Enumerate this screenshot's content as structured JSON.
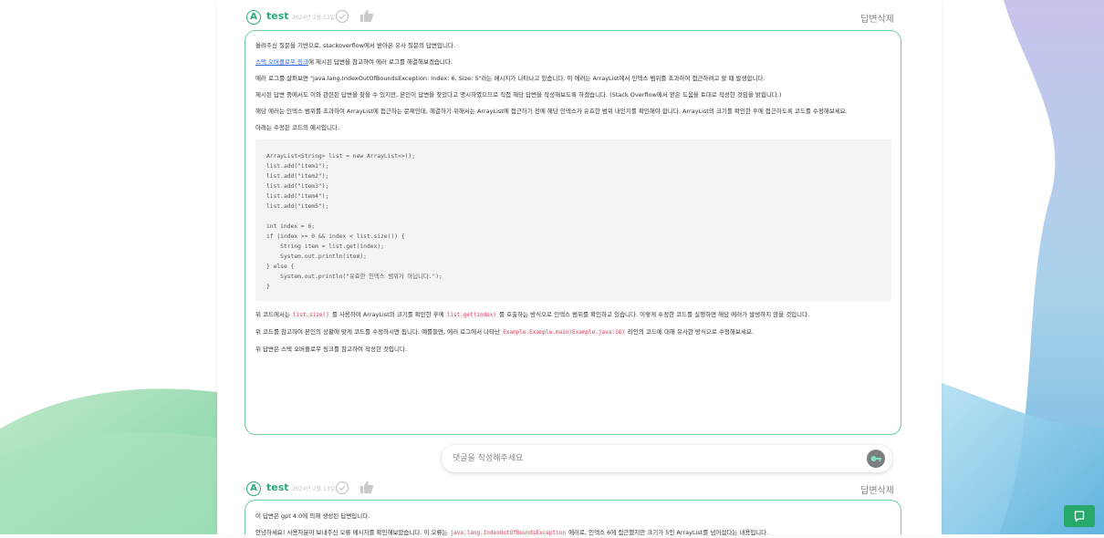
{
  "answers": [
    {
      "author": "test",
      "date": "2024년 2월 13일",
      "delete_label": "답변삭제",
      "paragraphs_before": [
        "올려주신 질문을 기반으로, stackoverflow에서 받아온 유사 질문의 답변입니다.",
        "",
        "에러 로그를 살펴보면 \"java.lang.IndexOutOfBoundsException: Index: 6, Size: 5\"라는 메시지가 나타나고 있습니다. 이 에러는 ArrayList에서 인덱스 범위를 초과하여 접근하려고 할 때 발생합니다.",
        "제시된 답변 중에서도 이와 관련된 답변을 찾을 수 있지만, 본인이 답변을 찾았다고 명시하였으므로 직접 해당 답변을 작성해보도록 하겠습니다. (Stack Overflow에서 얻은 도움을 토대로 작성한 것임을 밝힙니다.)",
        "해당 에러는 인덱스 범위를 초과하여 ArrayList에 접근하는 문제인데, 해결하기 위해서는 ArrayList에 접근하기 전에 해당 인덱스가 유효한 범위 내인지를 확인해야 합니다. ArrayList의 크기를 확인한 후에 접근하도록 코드를 수정해보세요.",
        "아래는 수정된 코드의 예시입니다."
      ],
      "link_text": "스택 오버플로우 링크",
      "link_suffix": "에 제시된 답변을 참고하여 에러 로그를 해결해보겠습니다.",
      "code_lines": [
        "ArrayList<String> list = new ArrayList<>();",
        "list.add(\"item1\");",
        "list.add(\"item2\");",
        "list.add(\"item3\");",
        "list.add(\"item4\");",
        "list.add(\"item5\");",
        "",
        "int index = 6;",
        "if (index >= 0 && index < list.size()) {",
        "    String item = list.get(index);",
        "    System.out.println(item);",
        "} else {",
        "    System.out.println(\"유효한 인덱스 범위가 아닙니다.\");",
        "}"
      ],
      "after1": {
        "t1": "위 코드에서는 ",
        "c1": "list.size()",
        "t2": " 를 사용하여 ArrayList의 크기를 확인한 후에 ",
        "c2": "list.get(index)",
        "t3": " 를 호출하는 방식으로 인덱스 범위를 확인하고 있습니다. 이렇게 수정한 코드를 실행하면 해당 에러가 발생하지 않을 것입니다."
      },
      "after2": {
        "t1": "위 코드를 참고하여 본인의 상황에 맞게 코드를 수정하시면 됩니다. 예를들면, 에러 로그에서 나타난 ",
        "c1": "Example.Example.main(Example.java:18)",
        "t2": " 라인의 코드에 대해 유사한 방식으로 수정해보세요."
      },
      "after3": "위 답변은 스택 오버플로우 링크를 참고하여 작성한 것입니다."
    },
    {
      "author": "test",
      "date": "2024년 2월 13일",
      "delete_label": "답변삭제",
      "line1": "이 답변은 gpt 4.0에 의해 생성된 답변입니다.",
      "line2_t1": "안녕하세요! 사용자분이 보내주신 오류 메시지를 확인해보았습니다. 이 오류는 ",
      "line2_c1": "java.lang.IndexOutOfBoundsException",
      "line2_t2": " 에러로, 인덱스 6에 접근했지만 크기가 5인 ArrayList를 넘어섰다는 내용입니다."
    }
  ],
  "comment": {
    "placeholder": "댓글을 작성해주세요"
  },
  "colors": {
    "accent": "#2aa876",
    "border": "#6fcf9f",
    "link": "#2b63d9",
    "code_inline": "#e0536b"
  },
  "icons": [
    "avatar-a-icon",
    "check-circle-icon",
    "thumbs-up-icon",
    "key-icon",
    "chat-icon"
  ]
}
